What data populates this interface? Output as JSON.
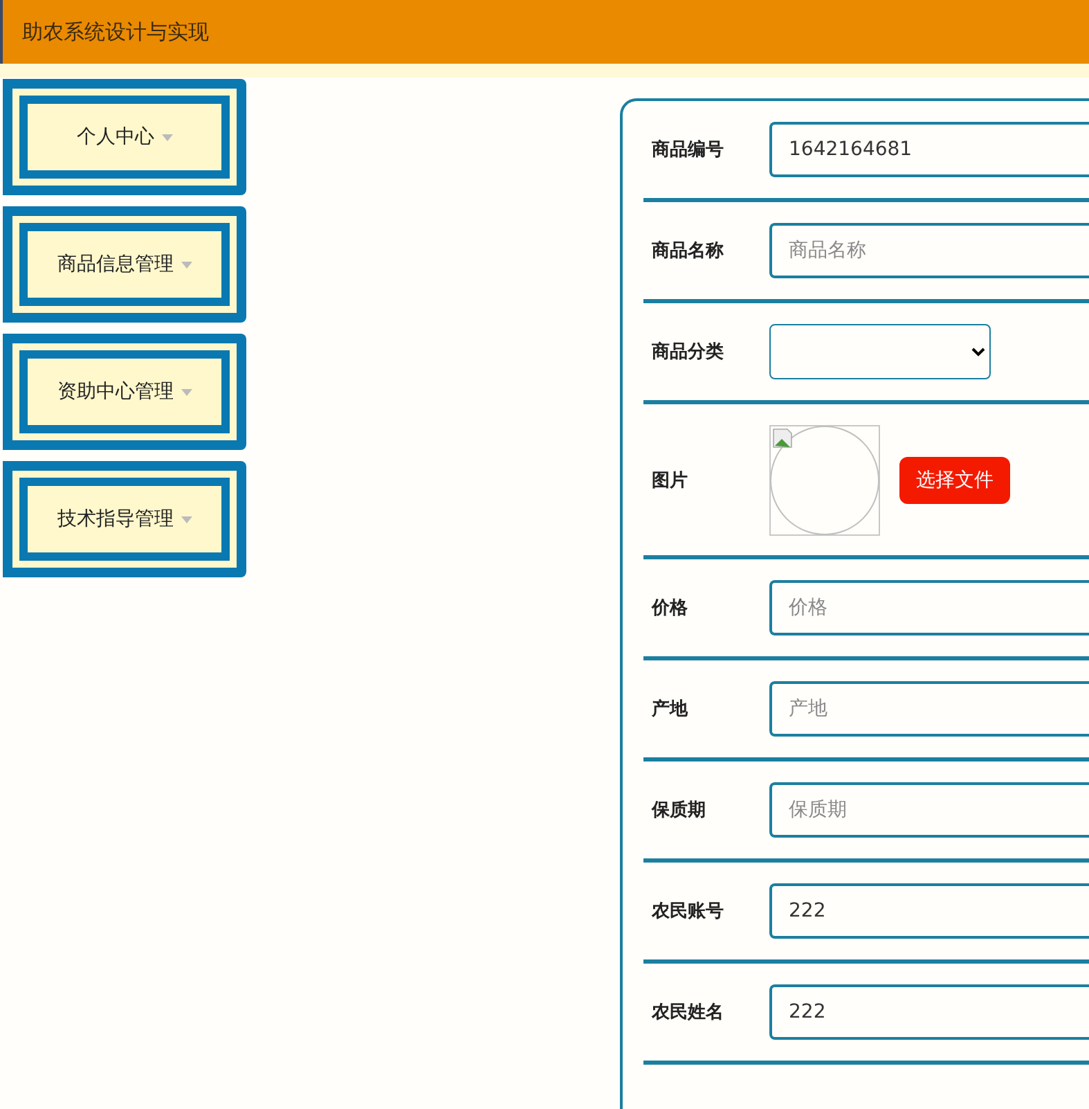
{
  "header": {
    "title": "助农系统设计与实现"
  },
  "menu": [
    {
      "label": "个人中心"
    },
    {
      "label": "商品信息管理"
    },
    {
      "label": "资助中心管理"
    },
    {
      "label": "技术指导管理"
    }
  ],
  "form": {
    "fields": [
      {
        "kind": "text",
        "label": "商品编号",
        "value": "1642164681"
      },
      {
        "kind": "text",
        "label": "商品名称",
        "placeholder": "商品名称"
      },
      {
        "kind": "select",
        "label": "商品分类"
      },
      {
        "kind": "image",
        "label": "图片",
        "button": "选择文件"
      },
      {
        "kind": "text",
        "label": "价格",
        "placeholder": "价格"
      },
      {
        "kind": "text",
        "label": "产地",
        "placeholder": "产地"
      },
      {
        "kind": "text",
        "label": "保质期",
        "placeholder": "保质期"
      },
      {
        "kind": "text",
        "label": "农民账号",
        "value": "222"
      },
      {
        "kind": "text",
        "label": "农民姓名",
        "value": "222"
      }
    ]
  }
}
